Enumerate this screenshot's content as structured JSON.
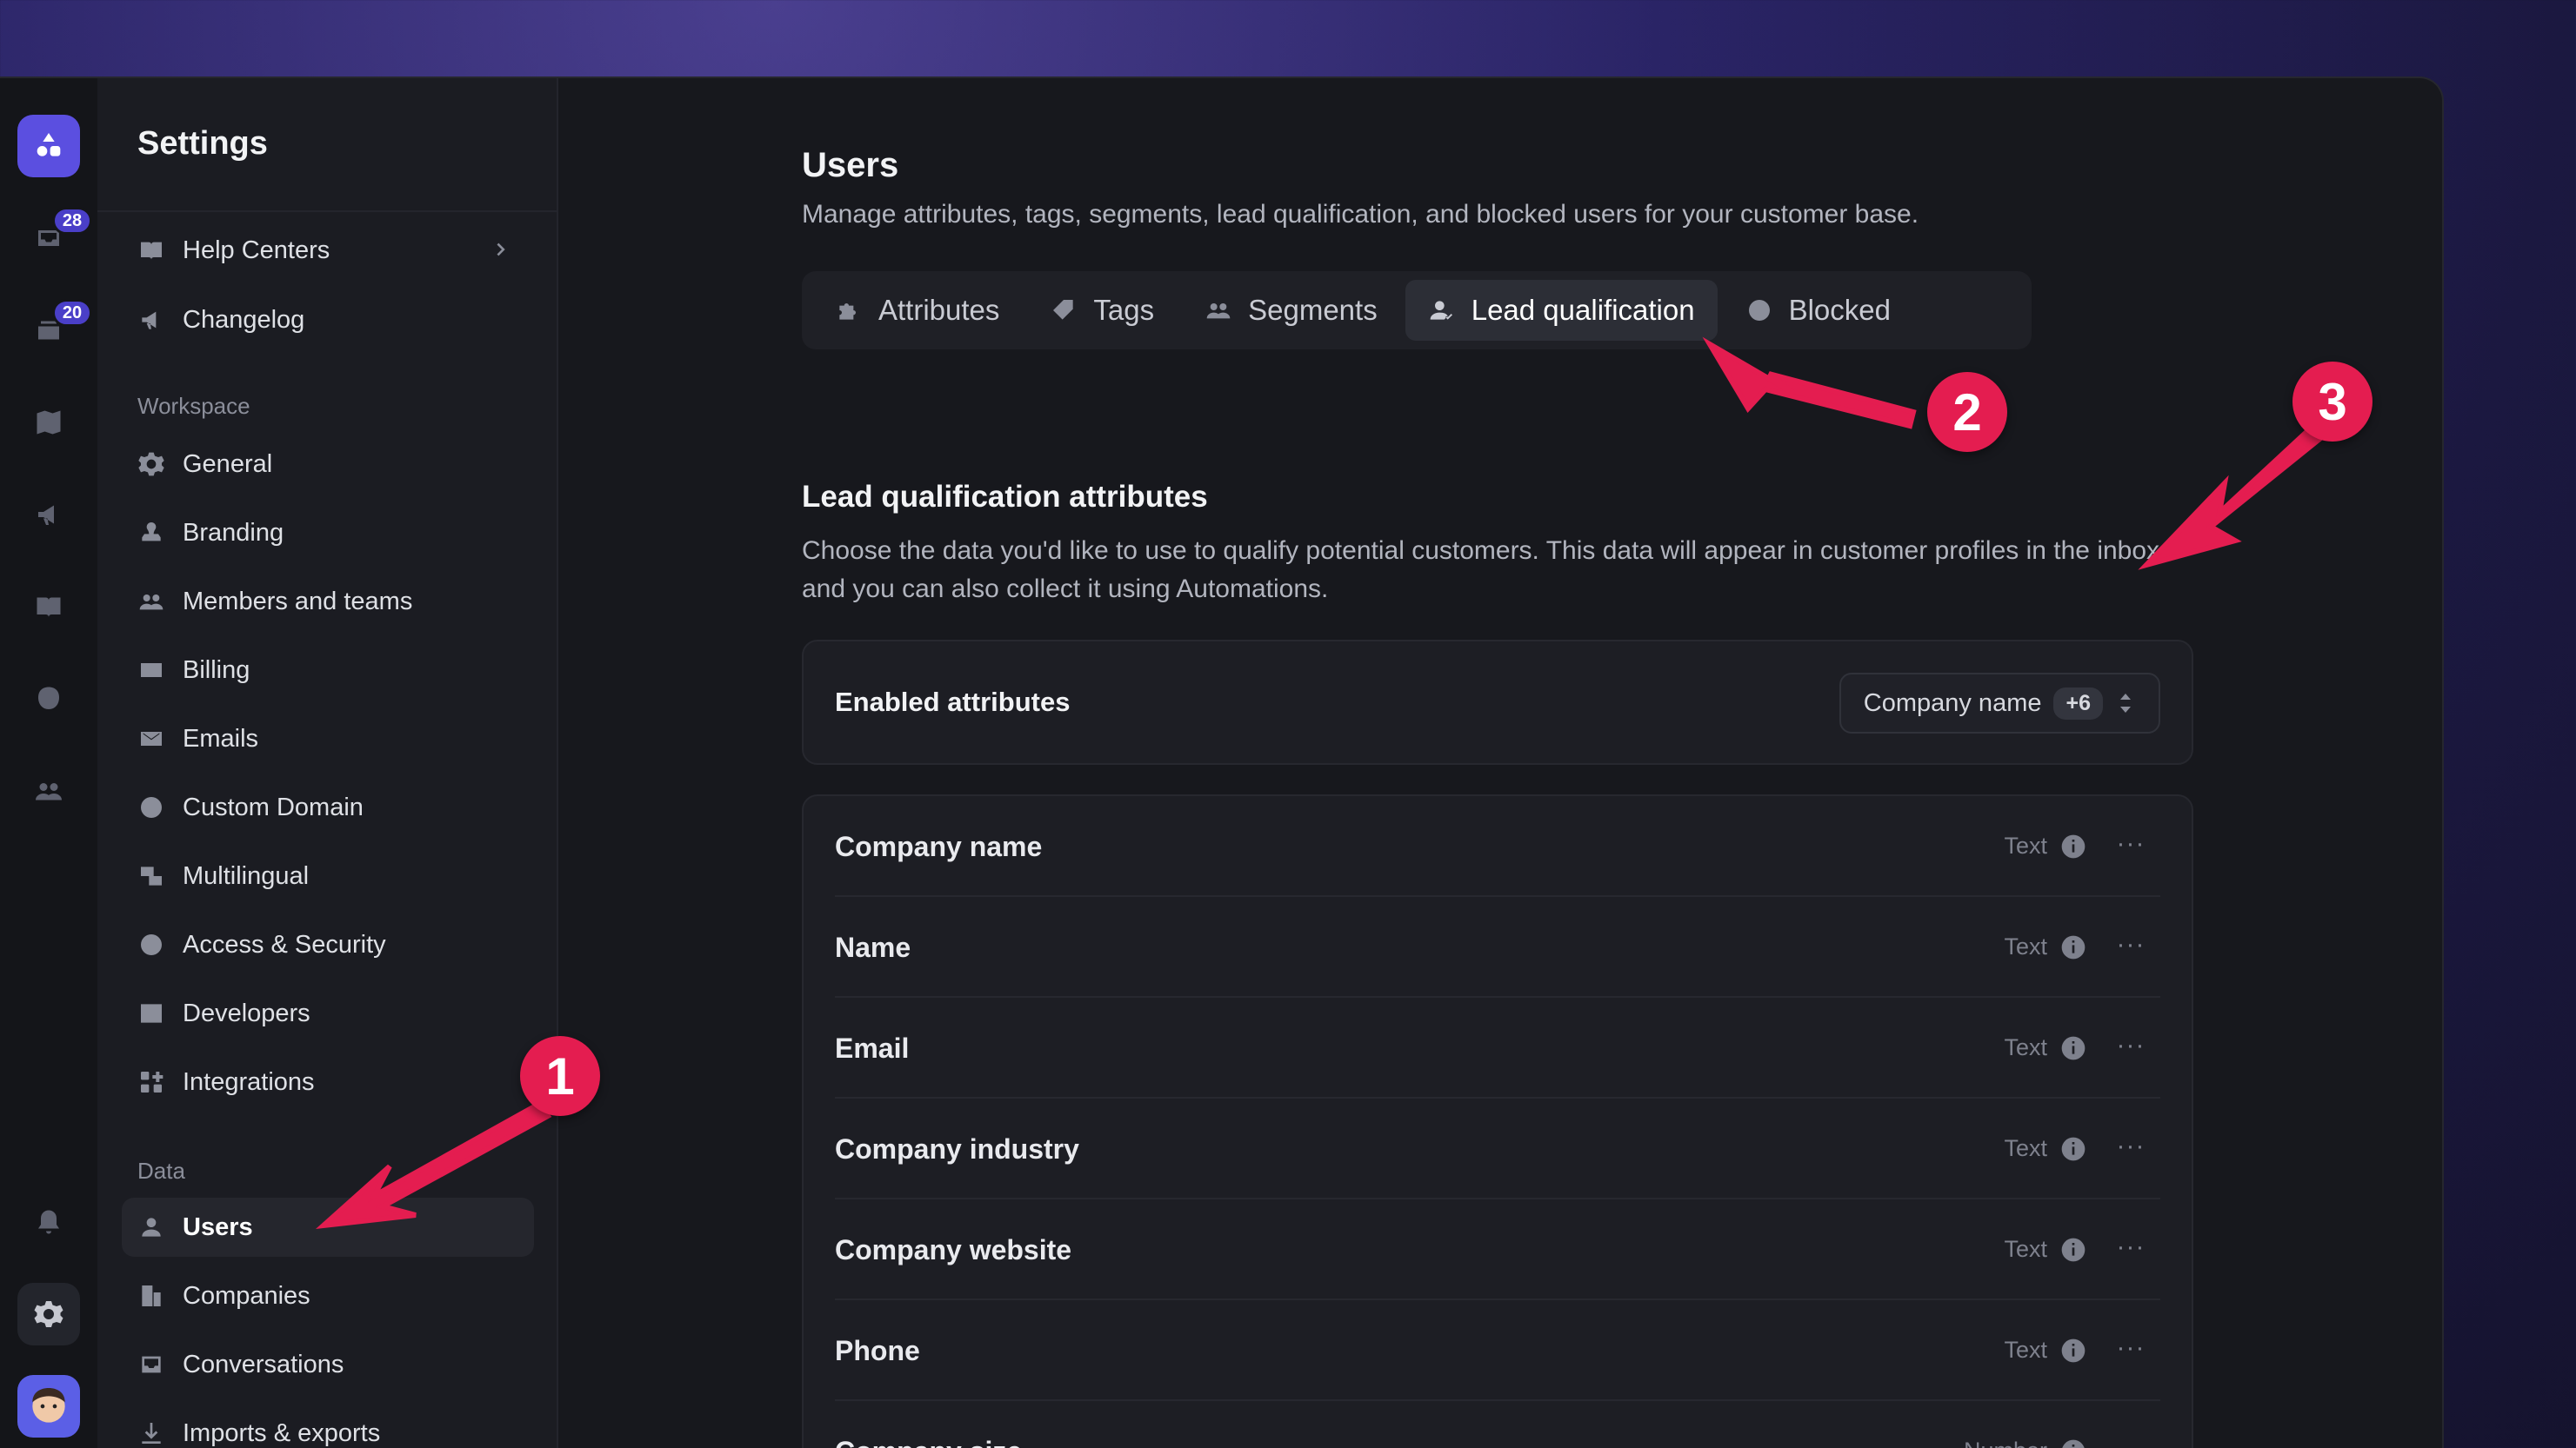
{
  "rail": {
    "badges": [
      "28",
      "20"
    ]
  },
  "sidebar": {
    "title": "Settings",
    "items_top": [
      {
        "label": "Help Centers",
        "icon": "book-icon"
      },
      {
        "label": "Changelog",
        "icon": "megaphone-icon"
      }
    ],
    "workspace_label": "Workspace",
    "workspace_items": [
      {
        "label": "General",
        "icon": "gear-icon"
      },
      {
        "label": "Branding",
        "icon": "stamp-icon"
      },
      {
        "label": "Members and teams",
        "icon": "users-icon"
      },
      {
        "label": "Billing",
        "icon": "card-icon"
      },
      {
        "label": "Emails",
        "icon": "mail-icon"
      },
      {
        "label": "Custom Domain",
        "icon": "globe-icon"
      },
      {
        "label": "Multilingual",
        "icon": "translate-icon"
      },
      {
        "label": "Access & Security",
        "icon": "shield-icon"
      },
      {
        "label": "Developers",
        "icon": "code-icon"
      },
      {
        "label": "Integrations",
        "icon": "grid-plus-icon"
      }
    ],
    "data_label": "Data",
    "data_items": [
      {
        "label": "Users",
        "icon": "user-icon",
        "active": true
      },
      {
        "label": "Companies",
        "icon": "building-icon"
      },
      {
        "label": "Conversations",
        "icon": "inbox-icon"
      },
      {
        "label": "Imports & exports",
        "icon": "download-icon"
      }
    ]
  },
  "main": {
    "title": "Users",
    "subtitle": "Manage attributes, tags, segments, lead qualification, and blocked users for your customer base.",
    "tabs": [
      {
        "label": "Attributes",
        "icon": "puzzle-icon"
      },
      {
        "label": "Tags",
        "icon": "tag-icon"
      },
      {
        "label": "Segments",
        "icon": "users-icon"
      },
      {
        "label": "Lead qualification",
        "icon": "user-check-icon",
        "active": true
      },
      {
        "label": "Blocked",
        "icon": "block-icon"
      }
    ],
    "section_title": "Lead qualification attributes",
    "section_desc": "Choose the data you'd like to use to qualify potential customers. This data will appear in customer profiles in the inbox, and you can also collect it using Automations.",
    "enabled": {
      "label": "Enabled attributes",
      "selected": "Company name",
      "more": "+6"
    },
    "attributes": [
      {
        "name": "Company name",
        "type": "Text"
      },
      {
        "name": "Name",
        "type": "Text"
      },
      {
        "name": "Email",
        "type": "Text"
      },
      {
        "name": "Company industry",
        "type": "Text"
      },
      {
        "name": "Company website",
        "type": "Text"
      },
      {
        "name": "Phone",
        "type": "Text"
      },
      {
        "name": "Company size",
        "type": "Number"
      }
    ],
    "menu_glyph": "···"
  },
  "annotations": [
    "1",
    "2",
    "3"
  ],
  "colors": {
    "accent": "#5b4fe0",
    "annotation": "#e41d50"
  }
}
